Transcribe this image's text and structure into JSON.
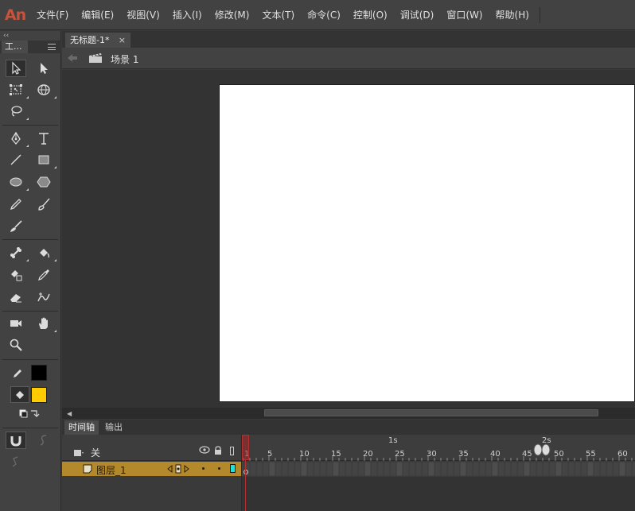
{
  "app": {
    "logo": "An"
  },
  "menu": [
    "文件(F)",
    "编辑(E)",
    "视图(V)",
    "插入(I)",
    "修改(M)",
    "文本(T)",
    "命令(C)",
    "控制(O)",
    "调试(D)",
    "窗口(W)",
    "帮助(H)"
  ],
  "tools_panel": {
    "collapse": "‹‹",
    "tab_label": "工..."
  },
  "document": {
    "tab_title": "无标题-1*",
    "close": "×"
  },
  "scene": {
    "label": "场景 1"
  },
  "colors": {
    "stroke": "#000000",
    "fill": "#ffcc00",
    "layer_highlight": "#b4892c",
    "playhead": "#b53030",
    "layer_outline": "#22e0e0"
  },
  "timeline": {
    "tabs": [
      "时间轴",
      "输出"
    ],
    "header_label": "关",
    "seconds": [
      "1s",
      "2s"
    ],
    "frame_numbers": [
      "1",
      "5",
      "10",
      "15",
      "20",
      "25",
      "30",
      "35",
      "40",
      "45",
      "50",
      "55",
      "60"
    ],
    "layer": {
      "name": "图层_1"
    }
  }
}
